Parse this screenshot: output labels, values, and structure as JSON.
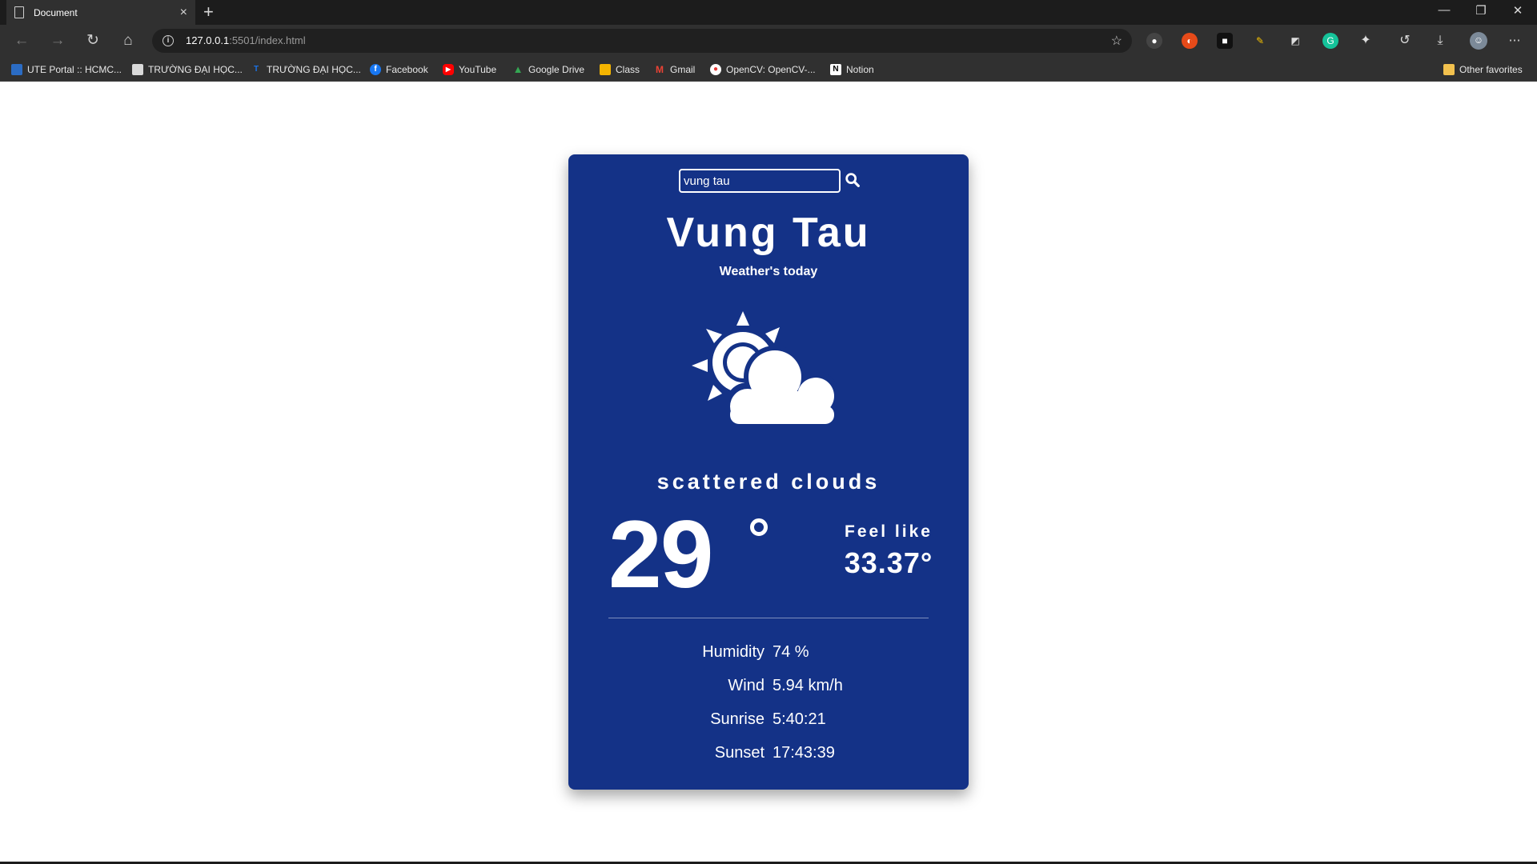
{
  "browser": {
    "tab_title": "Document",
    "tab_close": "×",
    "new_tab": "+",
    "url_host": "127.0.0.1",
    "url_path": ":5501/index.html",
    "bookmarks": [
      {
        "label": "UTE Portal :: HCMC...",
        "icon_color": "#2b6cc4",
        "icon": "portal-icon"
      },
      {
        "label": "TRƯỜNG ĐẠI HỌC...",
        "icon_color": "#d9d9d9",
        "icon": "school-icon"
      },
      {
        "label": "TRƯỜNG ĐẠI HỌC...",
        "icon_color": "#1a73e8",
        "icon": "school-icon"
      },
      {
        "label": "Facebook",
        "icon_color": "#1877f2",
        "icon": "facebook-icon"
      },
      {
        "label": "YouTube",
        "icon_color": "#ff0000",
        "icon": "youtube-icon"
      },
      {
        "label": "Google Drive",
        "icon_color": "#34a853",
        "icon": "google-drive-icon"
      },
      {
        "label": "Class",
        "icon_color": "#f4b400",
        "icon": "classroom-icon"
      },
      {
        "label": "Gmail",
        "icon_color": "#ea4335",
        "icon": "gmail-icon"
      },
      {
        "label": "OpenCV: OpenCV-...",
        "icon_color": "#e53935",
        "icon": "opencv-icon"
      },
      {
        "label": "Notion",
        "icon_color": "#ffffff",
        "icon": "notion-icon"
      }
    ],
    "other_favorites": "Other favorites"
  },
  "weather": {
    "search_value": "vung tau",
    "city": "Vung Tau",
    "subtitle": "Weather's today",
    "icon": "sun-cloud-icon",
    "description": "scattered clouds",
    "temperature": "29",
    "feel_like_label": "Feel like",
    "feel_like_value": "33.37°",
    "details": [
      {
        "label": "Humidity",
        "value": "74 %"
      },
      {
        "label": "Wind",
        "value": "5.94 km/h"
      },
      {
        "label": "Sunrise",
        "value": "5:40:21"
      },
      {
        "label": "Sunset",
        "value": "17:43:39"
      }
    ]
  },
  "colors": {
    "card_background": "#143287",
    "chrome_dark": "#1c1c1c",
    "chrome_toolbar": "#303030"
  }
}
